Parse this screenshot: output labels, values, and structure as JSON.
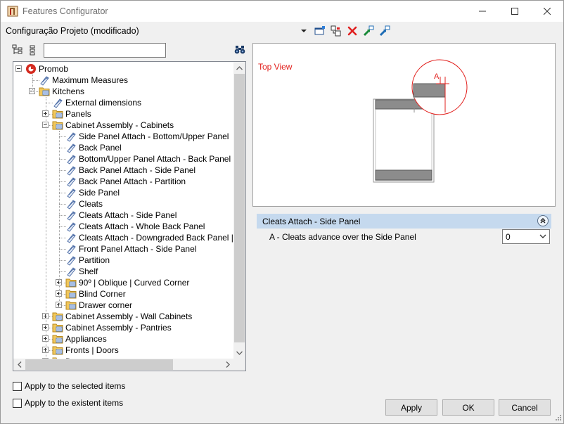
{
  "window": {
    "title": "Features Configurator"
  },
  "header": {
    "configuration_label": "Configuração Projeto (modificado)"
  },
  "search": {
    "value": "",
    "placeholder": ""
  },
  "tree": {
    "items": [
      {
        "label": "Promob",
        "level": 0,
        "expander": "minus",
        "icon": "promob-logo-icon"
      },
      {
        "label": "Maximum Measures",
        "level": 1,
        "expander": "none",
        "icon": "feature-tag-icon"
      },
      {
        "label": "Kitchens",
        "level": 1,
        "expander": "minus",
        "icon": "folder-icon"
      },
      {
        "label": "External dimensions",
        "level": 2,
        "expander": "none",
        "icon": "feature-tag-icon"
      },
      {
        "label": "Panels",
        "level": 2,
        "expander": "plus",
        "icon": "folder-icon"
      },
      {
        "label": "Cabinet Assembly - Cabinets",
        "level": 2,
        "expander": "minus",
        "icon": "folder-icon"
      },
      {
        "label": "Side Panel Attach - Bottom/Upper Panel",
        "level": 3,
        "expander": "none",
        "icon": "feature-tag-icon"
      },
      {
        "label": "Back Panel",
        "level": 3,
        "expander": "none",
        "icon": "feature-tag-icon"
      },
      {
        "label": " Bottom/Upper Panel Attach - Back Panel",
        "level": 3,
        "expander": "none",
        "icon": "feature-tag-icon"
      },
      {
        "label": "Back Panel Attach - Side Panel",
        "level": 3,
        "expander": "none",
        "icon": "feature-tag-icon"
      },
      {
        "label": "Back Panel Attach - Partition",
        "level": 3,
        "expander": "none",
        "icon": "feature-tag-icon"
      },
      {
        "label": "Side Panel",
        "level": 3,
        "expander": "none",
        "icon": "feature-tag-icon"
      },
      {
        "label": "Cleats",
        "level": 3,
        "expander": "none",
        "icon": "feature-tag-icon"
      },
      {
        "label": "Cleats Attach - Side Panel",
        "level": 3,
        "expander": "none",
        "icon": "feature-tag-icon"
      },
      {
        "label": "Cleats Attach - Whole Back Panel",
        "level": 3,
        "expander": "none",
        "icon": "feature-tag-icon"
      },
      {
        "label": "Cleats Attach - Downgraded Back Panel | Ba",
        "level": 3,
        "expander": "none",
        "icon": "feature-tag-icon"
      },
      {
        "label": "Front Panel Attach - Side Panel",
        "level": 3,
        "expander": "none",
        "icon": "feature-tag-icon"
      },
      {
        "label": "Partition",
        "level": 3,
        "expander": "none",
        "icon": "feature-tag-icon"
      },
      {
        "label": "Shelf",
        "level": 3,
        "expander": "none",
        "icon": "feature-tag-icon"
      },
      {
        "label": "90º | Oblique | Curved Corner",
        "level": 3,
        "expander": "plus",
        "icon": "folder-icon"
      },
      {
        "label": "Blind Corner",
        "level": 3,
        "expander": "plus",
        "icon": "folder-icon"
      },
      {
        "label": "Drawer corner",
        "level": 3,
        "expander": "plus",
        "icon": "folder-icon"
      },
      {
        "label": "Cabinet Assembly - Wall Cabinets",
        "level": 2,
        "expander": "plus",
        "icon": "folder-icon"
      },
      {
        "label": "Cabinet Assembly - Pantries",
        "level": 2,
        "expander": "plus",
        "icon": "folder-icon"
      },
      {
        "label": "Appliances",
        "level": 2,
        "expander": "plus",
        "icon": "folder-icon"
      },
      {
        "label": "Fronts | Doors",
        "level": 2,
        "expander": "plus",
        "icon": "folder-icon"
      },
      {
        "label": "D",
        "level": 2,
        "expander": "plus",
        "icon": "folder-icon"
      }
    ]
  },
  "options": {
    "apply_selected": "Apply to the selected items",
    "apply_existent": "Apply to the existent items"
  },
  "preview": {
    "view_label": "Top View",
    "dimension_letter": "A",
    "accent_color": "#e2201d"
  },
  "properties": {
    "group_title": "Cleats Attach - Side Panel",
    "rows": [
      {
        "label": "A - Cleats advance over the Side Panel",
        "value": "0"
      }
    ]
  },
  "buttons": {
    "apply": "Apply",
    "ok": "OK",
    "cancel": "Cancel"
  }
}
